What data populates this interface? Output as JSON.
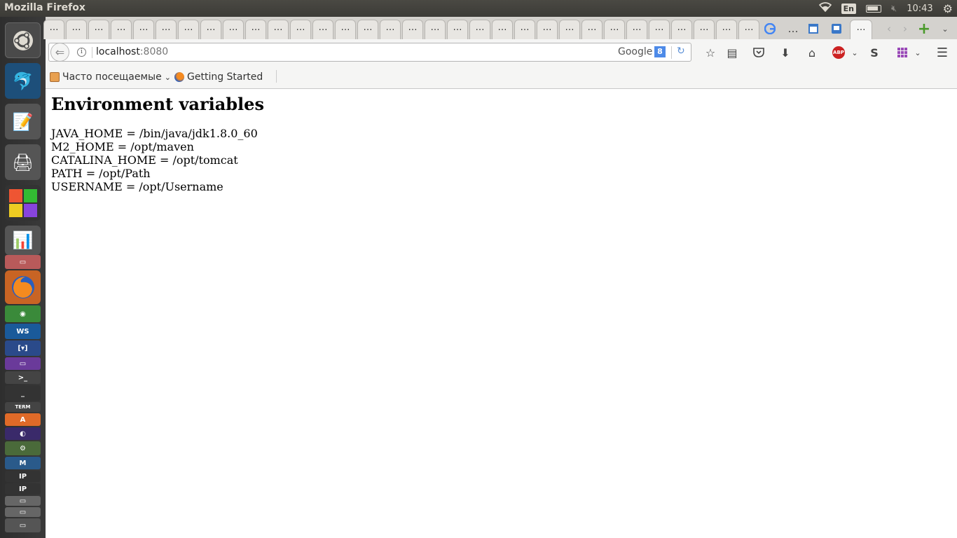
{
  "top_panel": {
    "title": "Mozilla Firefox",
    "keyboard_layout": "En",
    "clock": "10:43"
  },
  "browser": {
    "tabs": [
      "…",
      "…",
      "…",
      "…",
      "…",
      "…",
      "…",
      "…",
      "…",
      "…",
      "…",
      "…",
      "…",
      "…",
      "…",
      "…",
      "…",
      "…",
      "…",
      "…",
      "…",
      "…",
      "…",
      "…",
      "…",
      "…",
      "…",
      "…",
      "…",
      "…",
      "…",
      "…"
    ],
    "active_tab": "…",
    "url_host": "localhost",
    "url_port": ":8080",
    "search_engine": "Google",
    "search_icon_letter": "8",
    "bookmarks": [
      {
        "label": "Часто посещаемые",
        "icon": "folder-icon"
      },
      {
        "label": "Getting Started",
        "icon": "firefox-icon"
      }
    ],
    "addon_abp_label": "ABP"
  },
  "page": {
    "heading": "Environment variables",
    "variables": [
      "JAVA_HOME = /bin/java/jdk1.8.0_60",
      "M2_HOME = /opt/maven",
      "CATALINA_HOME = /opt/tomcat",
      "PATH = /opt/Path",
      "USERNAME = /opt/Username"
    ]
  },
  "colors": {
    "accent": "#5a8fd6",
    "launcher_bg": "#2e2e2e",
    "panel_bg": "#3c3b37",
    "abp_red": "#cc2222"
  }
}
